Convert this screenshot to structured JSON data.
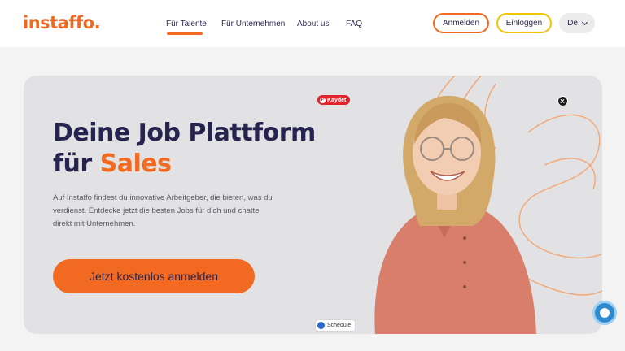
{
  "header": {
    "logo": "instaffo",
    "nav": [
      {
        "label": "Für Talente"
      },
      {
        "label": "Für Unternehmen"
      },
      {
        "label": "About us"
      },
      {
        "label": "FAQ"
      }
    ],
    "anmelden": "Anmelden",
    "einloggen": "Einloggen",
    "language": "De"
  },
  "hero": {
    "title_line1": "Deine Job Plattform",
    "title_line2_prefix": "für ",
    "title_line2_accent": "Sales",
    "description": "Auf Instaffo findest du innovative Arbeitgeber, die bieten, was du verdienst. Entdecke jetzt die besten Jobs für dich und chatte direkt mit Unternehmen.",
    "cta": "Jetzt kostenlos anmelden"
  },
  "overlays": {
    "pinterest_save": "Kaydet",
    "schedule": "Schedule"
  },
  "colors": {
    "brand_orange": "#f26a21",
    "navy": "#26234f",
    "yellow": "#f3c400"
  }
}
